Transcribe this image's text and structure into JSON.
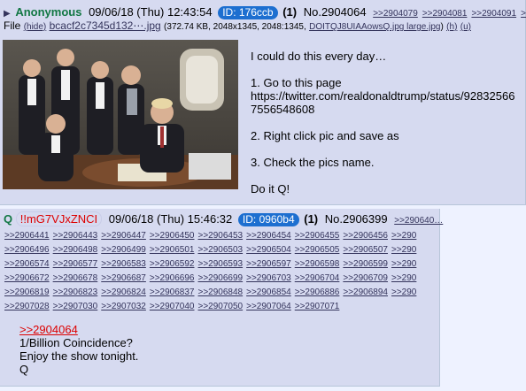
{
  "post1": {
    "arrow": "▶",
    "name": "Anonymous",
    "date": "09/06/18 (Thu) 12:43:54",
    "id": "ID: 176ccb",
    "count": "(1)",
    "no": "No.2904064",
    "backlinks": [
      ">>2904079",
      ">>2904081",
      ">>2904091",
      ">>"
    ],
    "file_label": "File",
    "hide": "(hide)",
    "filename": "bcacf2c7345d132⋯.jpg",
    "size_info": "(372.74 KB, 2048x1345, 2048:1345,",
    "orig_name": "DOITQJ8UIAAowsQ.jpg large.jpg",
    "close": ")",
    "h_link": "(h)",
    "u_link": "(u)",
    "lines": [
      "I could do this every day…",
      "1. Go to this page",
      "https://twitter.com/realdonaldtrump/status/928325667556548608",
      "2. Right click pic and save as",
      "3. Check the pics name.",
      "Do it Q!"
    ]
  },
  "post2": {
    "name": "Q",
    "trip": "!!mG7VJxZNCI",
    "date": "09/06/18 (Thu) 15:46:32",
    "id": "ID: 0960b4",
    "count": "(1)",
    "no": "No.2906399",
    "backlinks_head": ">>290640…",
    "backlink_rows": [
      [
        ">>2906441",
        ">>2906443",
        ">>2906447",
        ">>2906450",
        ">>2906453",
        ">>2906454",
        ">>2906455",
        ">>2906456",
        ">>290"
      ],
      [
        ">>2906496",
        ">>2906498",
        ">>2906499",
        ">>2906501",
        ">>2906503",
        ">>2906504",
        ">>2906505",
        ">>2906507",
        ">>290"
      ],
      [
        ">>2906574",
        ">>2906577",
        ">>2906583",
        ">>2906592",
        ">>2906593",
        ">>2906597",
        ">>2906598",
        ">>2906599",
        ">>290"
      ],
      [
        ">>2906672",
        ">>2906678",
        ">>2906687",
        ">>2906696",
        ">>2906699",
        ">>2906703",
        ">>2906704",
        ">>2906709",
        ">>290"
      ],
      [
        ">>2906819",
        ">>2906823",
        ">>2906824",
        ">>2906837",
        ">>2906848",
        ">>2906854",
        ">>2906886",
        ">>2906894",
        ">>290"
      ],
      [
        ">>2907028",
        ">>2907030",
        ">>2907032",
        ">>2907040",
        ">>2907050",
        ">>2907064",
        ">>2907071"
      ]
    ],
    "quote": ">>2904064",
    "lines": [
      "1/Billion Coincidence?",
      "Enjoy the show tonight.",
      "Q"
    ]
  }
}
